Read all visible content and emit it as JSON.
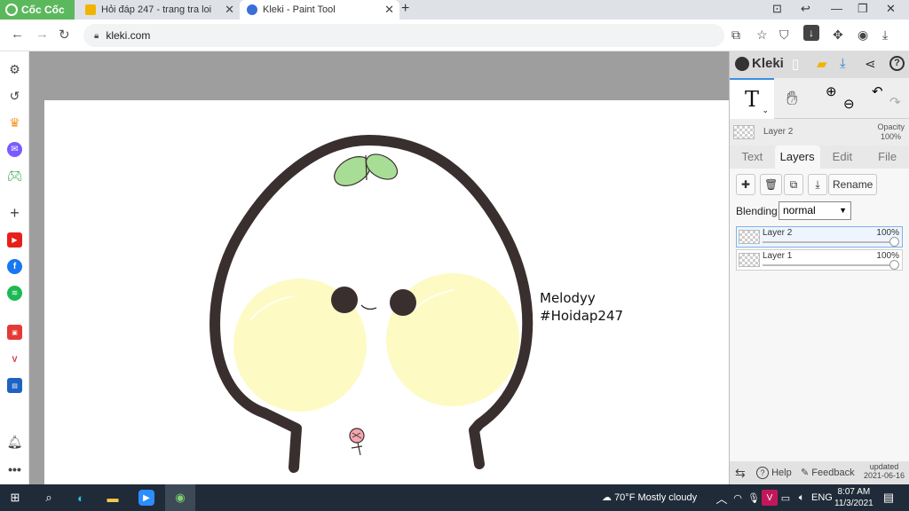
{
  "browser": {
    "brand": "Cốc Cốc",
    "tabs": [
      {
        "title": "Hỏi đáp 247 - trang tra loi"
      },
      {
        "title": "Kleki - Paint Tool"
      }
    ],
    "url": "kleki.com"
  },
  "canvas": {
    "caption_line1": "Melodyy",
    "caption_line2": "#Hoidap247"
  },
  "kleki": {
    "title": "Kleki",
    "current_layer": "Layer 2",
    "opacity_label": "Opacity",
    "opacity_value": "100%",
    "tabs": [
      "Text",
      "Layers",
      "Edit",
      "File"
    ],
    "rename_label": "Rename",
    "blending_label": "Blending",
    "blending_value": "normal",
    "layers": [
      {
        "name": "Layer 2",
        "opacity": "100%"
      },
      {
        "name": "Layer 1",
        "opacity": "100%"
      }
    ],
    "footer": {
      "help": "Help",
      "feedback": "Feedback",
      "updated_label": "updated",
      "updated_date": "2021-06-16"
    }
  },
  "taskbar": {
    "weather": "70°F  Mostly cloudy",
    "language": "ENG",
    "time": "8:07 AM",
    "date": "11/3/2021"
  },
  "colors": {
    "brand_green": "#5cb85c",
    "taskbar": "#1f2b38",
    "accent_blue": "#3b8fe0",
    "character_outline": "#3a2f2f",
    "cheeks": "#fdfac4",
    "sprout": "#a8dd95"
  }
}
